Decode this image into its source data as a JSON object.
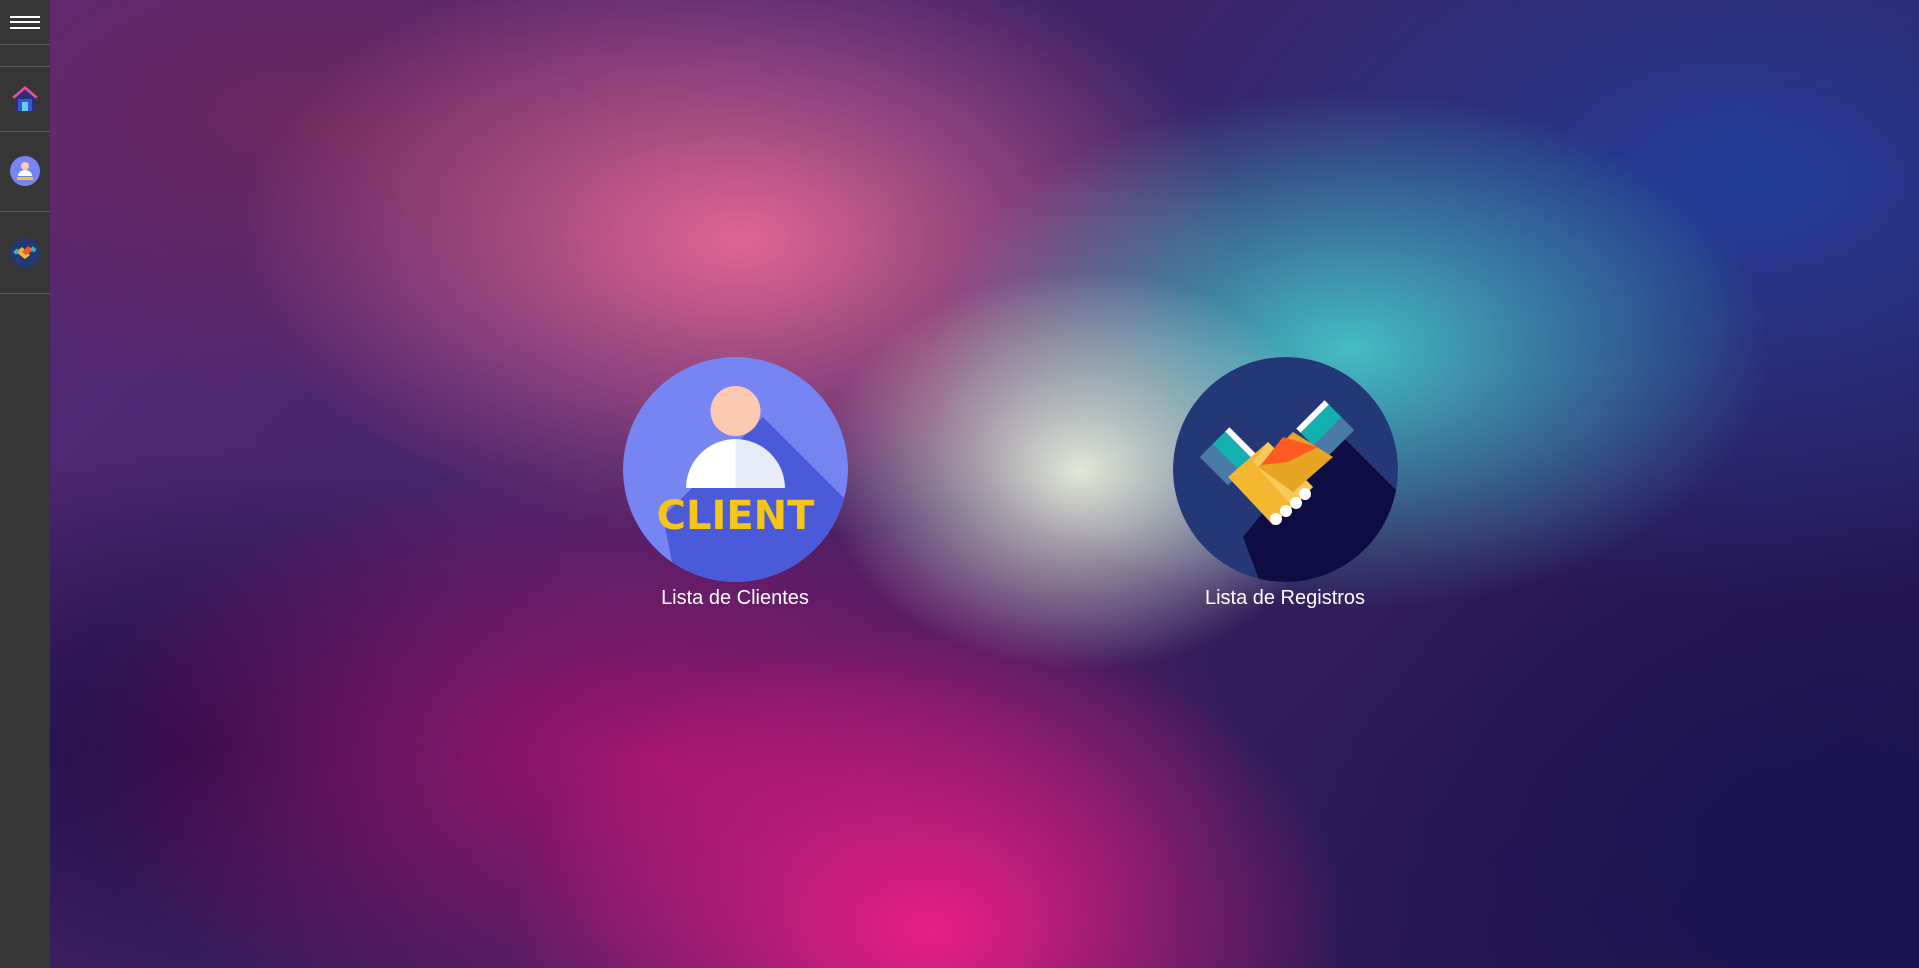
{
  "sidebar": {
    "menu_icon": "hamburger-menu-icon",
    "items": [
      {
        "icon": "home-icon"
      },
      {
        "icon": "client-icon"
      },
      {
        "icon": "handshake-icon"
      }
    ]
  },
  "tiles": [
    {
      "icon": "client-icon",
      "icon_text": "CLIENT",
      "label": "Lista de Clientes"
    },
    {
      "icon": "handshake-icon",
      "label": "Lista de Registros"
    }
  ],
  "colors": {
    "sidebar_bg": "#363636",
    "client_circle": "#7785f2",
    "client_text": "#f5c518",
    "handshake_circle": "#243877"
  }
}
